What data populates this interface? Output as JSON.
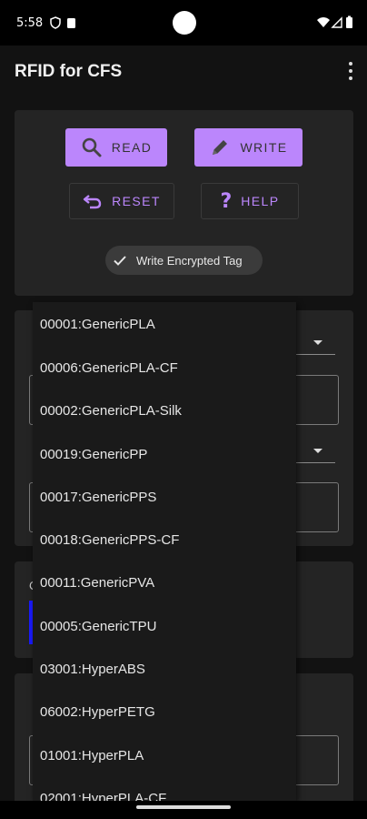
{
  "status_bar": {
    "time": "5:58"
  },
  "app_bar": {
    "title": "RFID for CFS"
  },
  "actions": {
    "read_label": "READ",
    "write_label": "WRITE",
    "reset_label": "RESET",
    "help_label": "HELP",
    "encrypted_chip_label": "Write Encrypted Tag",
    "encrypted_chip_checked": true
  },
  "partially_hidden": {
    "edge_char": "C"
  },
  "material_dropdown": {
    "items": [
      "00001:GenericPLA",
      "00006:GenericPLA-CF",
      "00002:GenericPLA-Silk",
      "00019:GenericPP",
      "00017:GenericPPS",
      "00018:GenericPPS-CF",
      "00011:GenericPVA",
      "00005:GenericTPU",
      "03001:HyperABS",
      "06002:HyperPETG",
      "01001:HyperPLA",
      "02001:HyperPLA-CF"
    ]
  },
  "colors": {
    "accent": "#bb86fc",
    "background": "#121212",
    "card": "#242424",
    "dropdown": "#1a1a1a",
    "color_swatch_edge": "#1a1aff"
  },
  "icons": {
    "read": "search-icon",
    "write": "pencil-icon",
    "reset": "undo-icon",
    "help": "question-icon",
    "chip": "check-icon",
    "menu": "more-vert-icon"
  }
}
